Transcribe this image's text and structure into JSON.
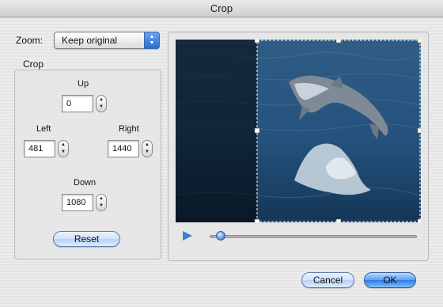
{
  "window": {
    "title": "Crop"
  },
  "zoom": {
    "label": "Zoom:",
    "value": "Keep original"
  },
  "crop": {
    "legend": "Crop",
    "up": {
      "label": "Up",
      "value": "0"
    },
    "left": {
      "label": "Left",
      "value": "481"
    },
    "right": {
      "label": "Right",
      "value": "1440"
    },
    "down": {
      "label": "Down",
      "value": "1080"
    },
    "reset_label": "Reset"
  },
  "player": {
    "play_icon": "play-icon",
    "position_fraction": 0.03
  },
  "footer": {
    "cancel_label": "Cancel",
    "ok_label": "OK"
  },
  "colors": {
    "accent": "#3d7fd6",
    "crop_line": "#ffffff"
  }
}
